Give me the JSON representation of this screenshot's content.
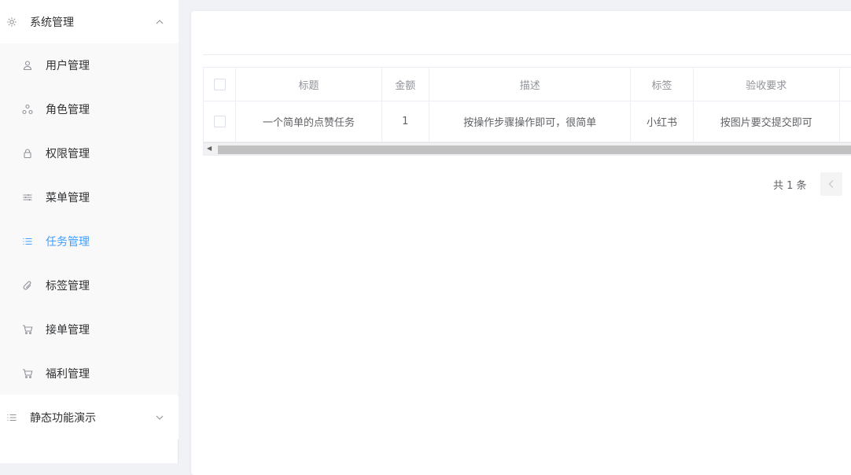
{
  "sidebar": {
    "group1": {
      "label": "系统管理",
      "icon": "gear-icon",
      "expanded": true
    },
    "items": [
      {
        "label": "用户管理",
        "icon": "user-icon"
      },
      {
        "label": "角色管理",
        "icon": "role-icon"
      },
      {
        "label": "权限管理",
        "icon": "lock-icon"
      },
      {
        "label": "菜单管理",
        "icon": "menu-sliders-icon"
      },
      {
        "label": "任务管理",
        "icon": "list-icon",
        "active": true
      },
      {
        "label": "标签管理",
        "icon": "paperclip-icon"
      },
      {
        "label": "接单管理",
        "icon": "cart-icon"
      },
      {
        "label": "福利管理",
        "icon": "cart-icon"
      }
    ],
    "group2": {
      "label": "静态功能演示",
      "icon": "list-icon",
      "expanded": false
    }
  },
  "table": {
    "headers": [
      "标题",
      "金额",
      "描述",
      "标签",
      "验收要求"
    ],
    "rows": [
      [
        "一个简单的点赞任务",
        "1",
        "按操作步骤操作即可，很简单",
        "小红书",
        "按图片要交提交即可"
      ]
    ]
  },
  "pagination": {
    "total_text": "共 1 条"
  },
  "colors": {
    "accent": "#409eff",
    "submenu_bg": "#f9f9f9",
    "page_bg": "#f0f2f5"
  }
}
